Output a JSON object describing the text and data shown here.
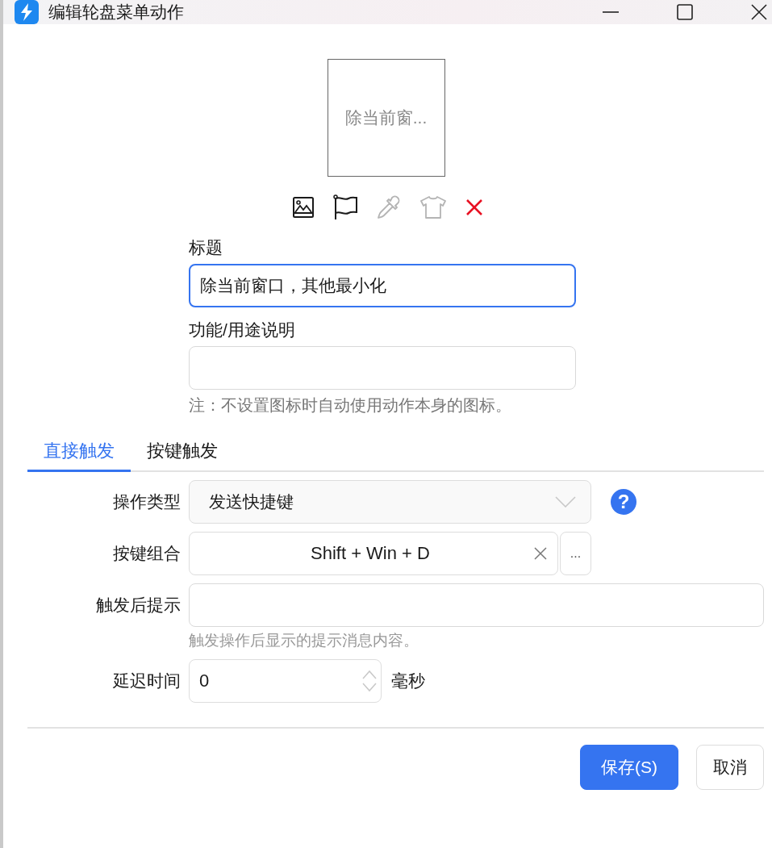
{
  "window": {
    "title": "编辑轮盘菜单动作"
  },
  "preview": {
    "label": "除当前窗..."
  },
  "icon_toolbar": [
    {
      "kind": "image",
      "disabled": false
    },
    {
      "kind": "flag",
      "disabled": false
    },
    {
      "kind": "eyedropper",
      "disabled": true
    },
    {
      "kind": "shirt",
      "disabled": true
    },
    {
      "kind": "clear",
      "disabled": false
    }
  ],
  "title_field": {
    "label": "标题",
    "value": "除当前窗口，其他最小化",
    "focused": true
  },
  "description_field": {
    "label": "功能/用途说明"
  },
  "note": "注：不设置图标时自动使用动作本身的图标。",
  "tabs": [
    {
      "label": "直接触发",
      "selected": true
    },
    {
      "label": "按键触发",
      "selected": false
    }
  ],
  "operation_type": {
    "label": "操作类型",
    "value": "发送快捷键",
    "help": "?"
  },
  "key_combo": {
    "label": "按键组合",
    "value": "Shift + Win + D",
    "more": "..."
  },
  "prompt": {
    "label": "触发后提示",
    "hint": "触发操作后显示的提示消息内容。"
  },
  "delay": {
    "label": "延迟时间",
    "value": "0",
    "unit": "毫秒"
  },
  "buttons": [
    {
      "label": "保存(S)",
      "kind": "primary"
    },
    {
      "label": "取消",
      "kind": "secondary"
    }
  ]
}
